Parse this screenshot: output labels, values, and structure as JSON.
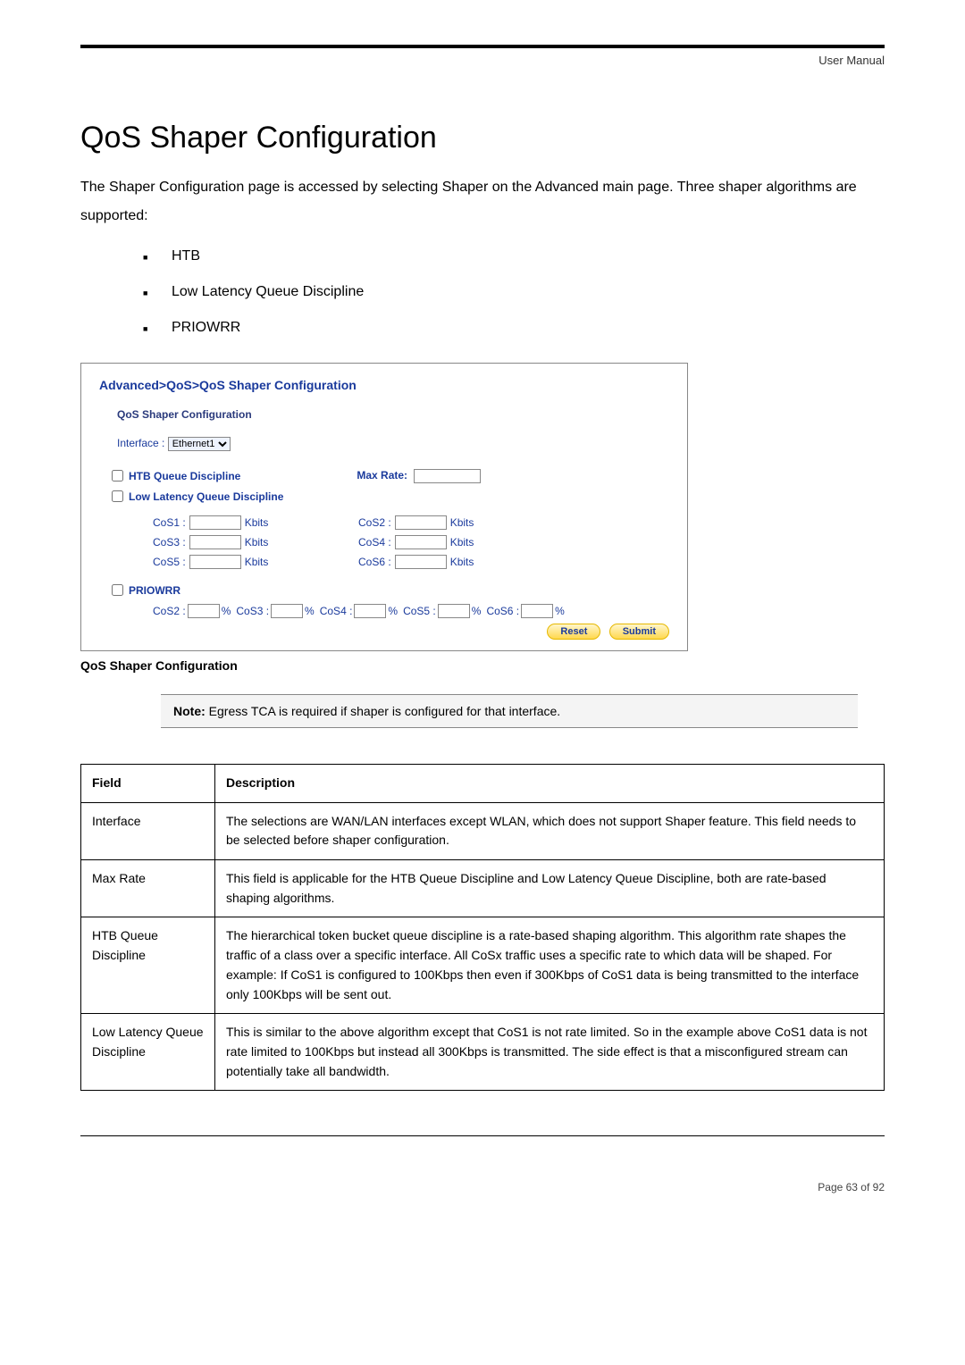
{
  "header": {
    "doc_label": "User Manual"
  },
  "title": "QoS Shaper Configuration",
  "intro": "The Shaper Configuration page is accessed by selecting Shaper on the Advanced main page. Three shaper algorithms are supported:",
  "bullets": [
    "HTB",
    "Low Latency Queue Discipline",
    "PRIOWRR"
  ],
  "panel": {
    "breadcrumb": "Advanced>QoS>QoS Shaper Configuration",
    "section": "QoS Shaper Configuration",
    "interface_label": "Interface :",
    "interface_value": "Ethernet1",
    "htb_label": "HTB Queue Discipline",
    "max_rate_label": "Max Rate:",
    "llq_label": "Low Latency Queue Discipline",
    "unit": "Kbits",
    "cos": {
      "c1": "CoS1 :",
      "c2": "CoS2 :",
      "c3": "CoS3 :",
      "c4": "CoS4 :",
      "c5": "CoS5 :",
      "c6": "CoS6 :"
    },
    "priowrr_label": "PRIOWRR",
    "pct": "%",
    "pr": {
      "c2": "CoS2 :",
      "c3": "CoS3 :",
      "c4": "CoS4 :",
      "c5": "CoS5 :",
      "c6": "CoS6 :"
    },
    "reset": "Reset",
    "submit": "Submit"
  },
  "caption": "QoS Shaper Configuration",
  "note": {
    "label": "Note:",
    "text": " Egress TCA is required if shaper is configured for that interface."
  },
  "table": {
    "h_field": "Field",
    "h_desc": "Description",
    "rows": [
      {
        "field": "Interface",
        "desc": "The selections are WAN/LAN interfaces except WLAN, which does not support Shaper feature. This field needs to be selected before shaper configuration."
      },
      {
        "field": "Max Rate",
        "desc": "This field is applicable for the HTB Queue Discipline and Low Latency Queue Discipline, both are rate-based shaping algorithms."
      },
      {
        "field": "HTB Queue Discipline",
        "desc": "The hierarchical token bucket queue discipline is a rate-based shaping algorithm. This algorithm rate shapes the traffic of a class over a specific interface. All CoSx traffic uses a specific rate to which data will be shaped. For example: If CoS1 is configured to 100Kbps then even if 300Kbps of CoS1 data is being transmitted to the interface only 100Kbps will be sent out."
      },
      {
        "field": "Low Latency Queue Discipline",
        "desc": "This is similar to the above algorithm except that CoS1 is not rate limited. So in the example above CoS1 data is not rate limited to 100Kbps but instead all 300Kbps is transmitted. The side effect is that a misconfigured stream can potentially take all bandwidth."
      }
    ]
  },
  "footer": {
    "page": "Page 63 of 92"
  }
}
